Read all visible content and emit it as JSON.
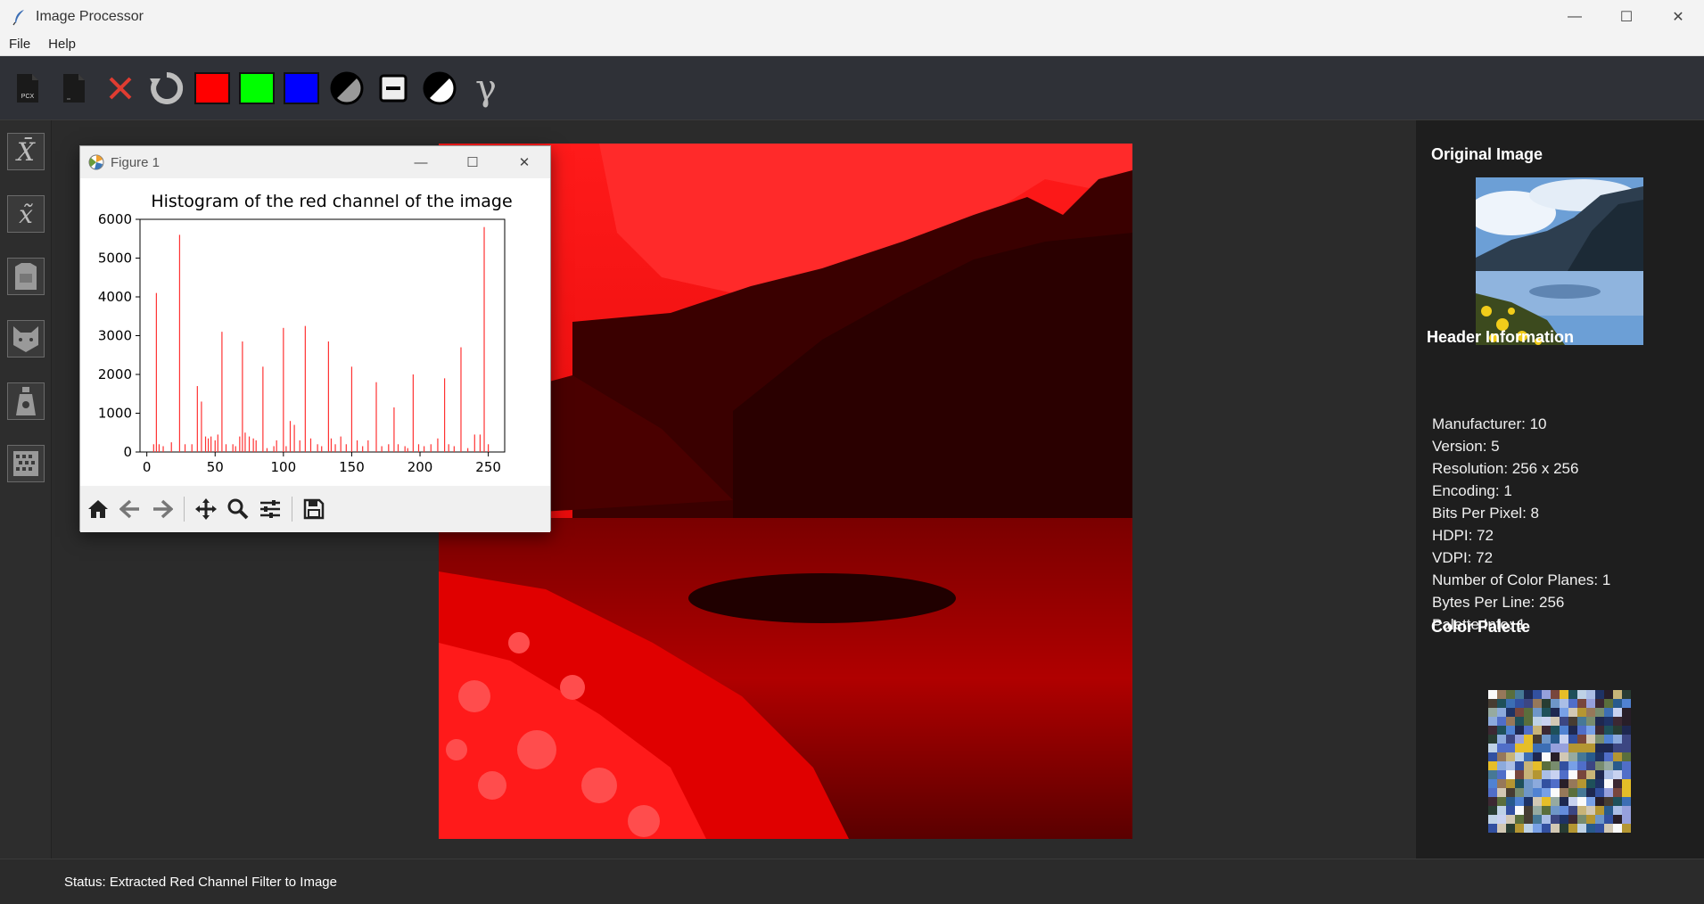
{
  "window": {
    "title": "Image Processor",
    "minimize": "—",
    "maximize": "☐",
    "close": "✕"
  },
  "menu": {
    "items": [
      {
        "label": "File"
      },
      {
        "label": "Help"
      }
    ]
  },
  "toolbar": {
    "tools": [
      {
        "name": "open-pcx-icon",
        "label": "PCX"
      },
      {
        "name": "new-file-icon"
      },
      {
        "name": "close-icon"
      },
      {
        "name": "reset-icon"
      },
      {
        "name": "red-channel-button",
        "color": "#ff0000"
      },
      {
        "name": "green-channel-button",
        "color": "#00ff00"
      },
      {
        "name": "blue-channel-button",
        "color": "#0000ff"
      },
      {
        "name": "grayscale-icon"
      },
      {
        "name": "minus-icon"
      },
      {
        "name": "negative-icon"
      },
      {
        "name": "gamma-icon",
        "glyph": "γ"
      }
    ]
  },
  "sidebar": {
    "buttons": [
      {
        "name": "mean-filter-icon",
        "glyph": "X̄"
      },
      {
        "name": "median-filter-icon",
        "glyph": "x̃"
      },
      {
        "name": "shirt-icon"
      },
      {
        "name": "cat-icon"
      },
      {
        "name": "lab-icon"
      },
      {
        "name": "grid-icon"
      }
    ]
  },
  "figure": {
    "title": "Figure 1",
    "minimize": "—",
    "maximize": "☐",
    "close": "✕"
  },
  "chart_data": {
    "type": "bar",
    "title": "Histogram of the red channel of the image",
    "xlabel": "",
    "ylabel": "",
    "xlim": [
      -5,
      262
    ],
    "ylim": [
      0,
      6000
    ],
    "xticks": [
      0,
      50,
      100,
      150,
      200,
      250
    ],
    "yticks": [
      0,
      1000,
      2000,
      3000,
      4000,
      5000,
      6000
    ],
    "color": "#ff3333",
    "x": [
      5,
      7,
      9,
      12,
      18,
      24,
      28,
      33,
      37,
      40,
      43,
      45,
      47,
      50,
      52,
      55,
      58,
      63,
      65,
      68,
      70,
      72,
      75,
      78,
      80,
      85,
      88,
      93,
      95,
      100,
      102,
      105,
      108,
      112,
      116,
      120,
      125,
      128,
      133,
      135,
      138,
      142,
      146,
      150,
      154,
      158,
      162,
      168,
      172,
      177,
      181,
      184,
      189,
      191,
      195,
      199,
      203,
      208,
      213,
      218,
      221,
      225,
      230,
      235,
      240,
      244,
      247,
      250
    ],
    "values": [
      200,
      4100,
      200,
      150,
      250,
      5600,
      200,
      200,
      1700,
      1300,
      400,
      350,
      400,
      300,
      450,
      3100,
      200,
      200,
      150,
      400,
      2850,
      500,
      400,
      350,
      300,
      2200,
      100,
      150,
      300,
      3200,
      150,
      800,
      700,
      300,
      3250,
      350,
      200,
      150,
      2850,
      350,
      200,
      400,
      200,
      2200,
      300,
      150,
      300,
      1800,
      150,
      200,
      1150,
      200,
      150,
      100,
      2000,
      200,
      150,
      200,
      350,
      1900,
      200,
      150,
      2700,
      100,
      450,
      450,
      5800,
      200
    ]
  },
  "right_panel": {
    "original_heading": "Original Image",
    "header_heading": "Header Information",
    "header_items": [
      "Manufacturer: 10",
      "Version: 5",
      "Resolution: 256 x 256",
      "Encoding: 1",
      "Bits Per Pixel: 8",
      "HDPI: 72",
      "VDPI: 72",
      "Number of Color Planes: 1",
      "Bytes Per Line: 256",
      "Palette Info: 1"
    ],
    "palette_heading": "Color Palette"
  },
  "status": {
    "text": "Status: Extracted Red Channel Filter to Image"
  }
}
